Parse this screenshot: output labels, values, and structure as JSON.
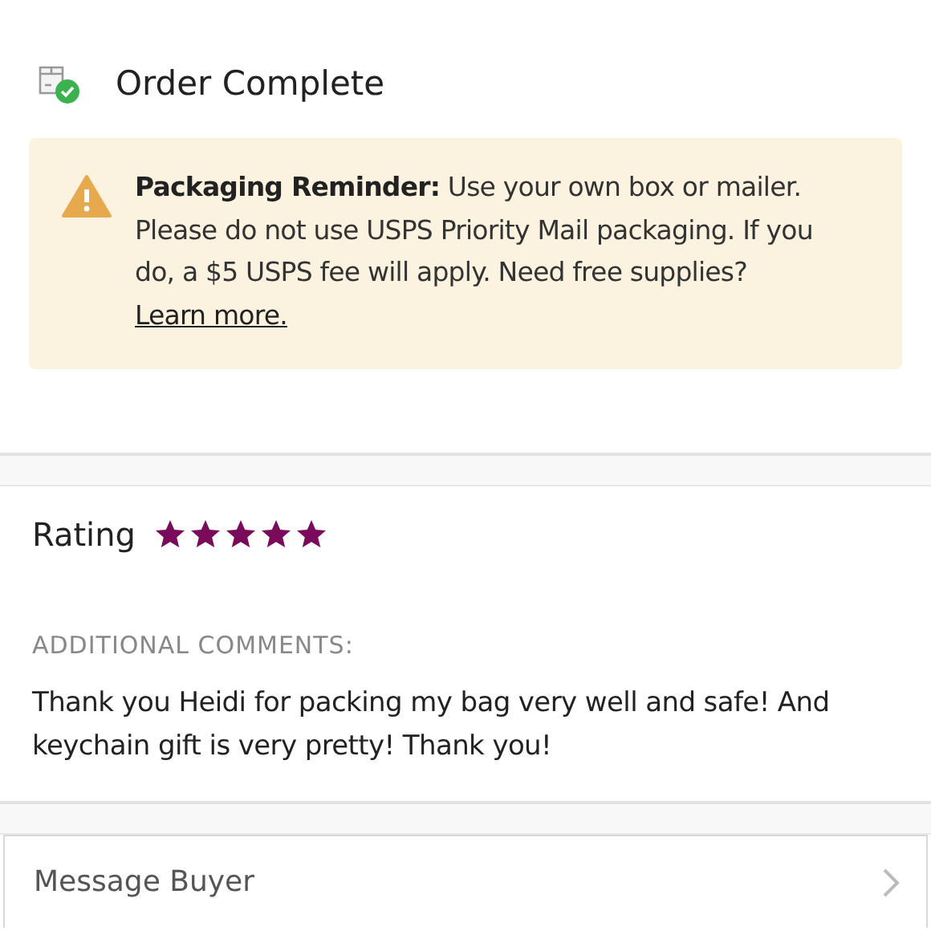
{
  "order_status": {
    "title": "Order Complete"
  },
  "reminder": {
    "text": "**Packaging Reminder:** Use your own box or mailer. Please do not use USPS Priority Mail packaging. If you do, a $5 USPS fee will apply. Need free supplies?",
    "link": "Learn more."
  },
  "rating": {
    "label": "Rating",
    "stars": 5
  },
  "comments": {
    "heading": "ADDITIONAL COMMENTS:",
    "text": "Thank you Heidi for packing my bag very well and safe! And keychain gift is very pretty! Thank you!"
  },
  "message_buyer": {
    "label": "Message Buyer"
  }
}
